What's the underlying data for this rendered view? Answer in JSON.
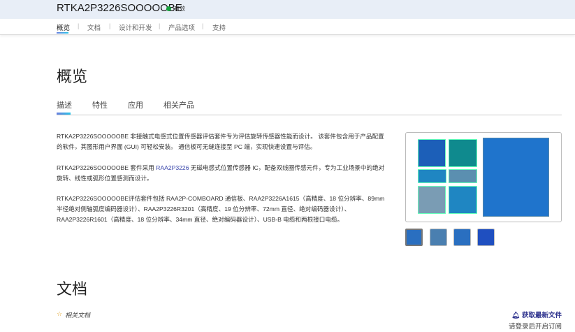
{
  "header": {
    "title": "RTKA2P3226SOOOOOBE",
    "status": "有效",
    "status_color": "#14a33c"
  },
  "nav": [
    "概览",
    "文档",
    "设计和开发",
    "产品选项",
    "支持"
  ],
  "overview": {
    "heading": "概览",
    "tabs": [
      "描述",
      "特性",
      "应用",
      "相关产品"
    ],
    "p1": "RTKA2P3226SOOOOOBE 非接触式电感式位置传感器评估套件专为评估旋转传感器性能而设计。 该套件包含用于产品配置的软件，其图形用户界面 (GUI) 可轻松安装。 通信板可无缝连接至 PC 端，实现快速设置与评估。",
    "p2_pre": "RTKA2P3226SOOOOOBE 套件采用 ",
    "p2_link": "RAA2P3226",
    "p2_post": " 无磁电感式位置传感器 IC，配备双线圈传感元件，专为工业场景中的绝对旋转、线性或弧形位置感测而设计。",
    "p3": "RTKA2P3226SOOOOOBE评估套件包括 RAA2P-COMBOARD 通信板、RAA2P3226A1615（高精度、18 位分辨率、89mm 半径绝对侧轴弧度编码器设计）、RAA2P3226R3201（高精度、19 位分辨率、72mm 直径、绝对编码器设计）、RAA2P3226R1601（高精度、18 位分辨率、34mm 直径、绝对编码器设计）、USB-B 电缆和两根接口电缆。"
  },
  "docs": {
    "heading": "文档",
    "related": "相关文档",
    "get_latest": "获取最新文件",
    "login_hint": "请登录后开启订阅"
  }
}
